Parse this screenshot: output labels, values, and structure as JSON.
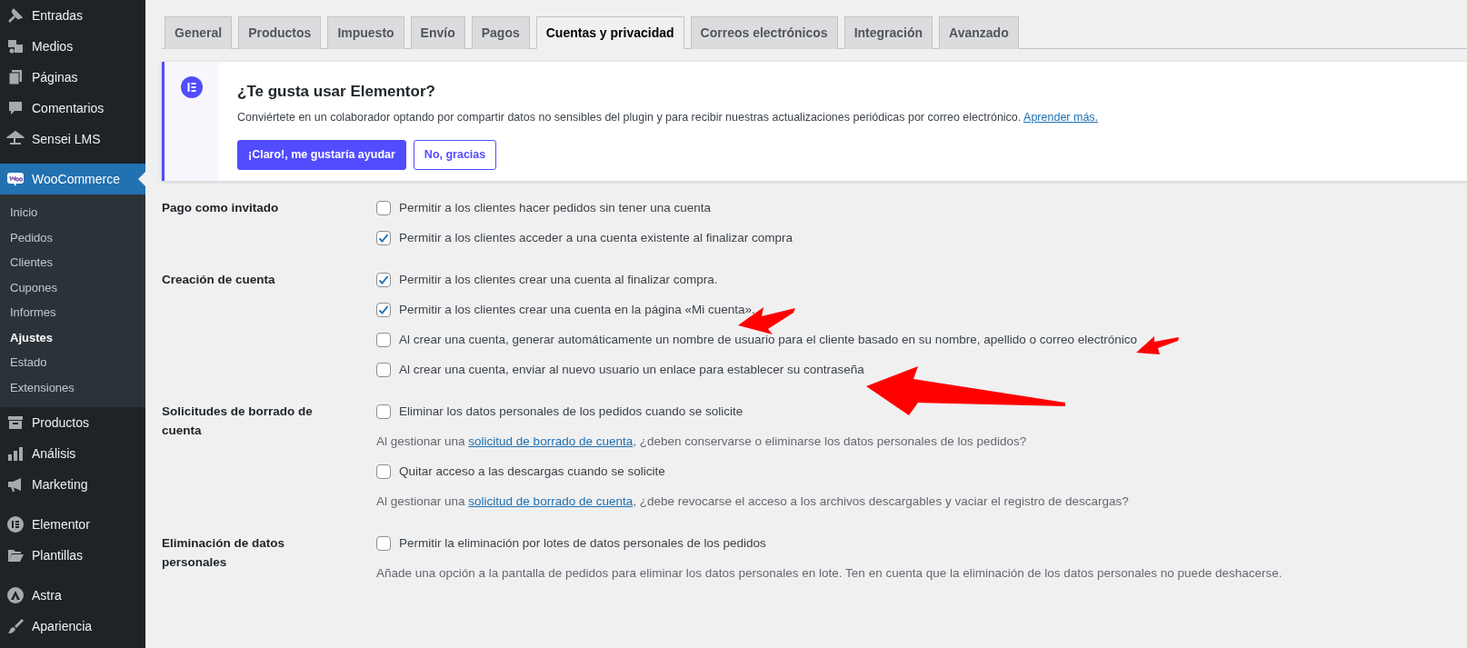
{
  "sidebar": {
    "items": [
      {
        "label": "Entradas",
        "selected": false
      },
      {
        "label": "Medios",
        "selected": false
      },
      {
        "label": "Páginas",
        "selected": false
      },
      {
        "label": "Comentarios",
        "selected": false
      },
      {
        "label": "Sensei LMS",
        "selected": false,
        "group_end": true
      },
      {
        "label": "WooCommerce",
        "selected": true,
        "expanded": true,
        "children": [
          {
            "label": "Inicio",
            "selected": false
          },
          {
            "label": "Pedidos",
            "selected": false
          },
          {
            "label": "Clientes",
            "selected": false
          },
          {
            "label": "Cupones",
            "selected": false
          },
          {
            "label": "Informes",
            "selected": false
          },
          {
            "label": "Ajustes",
            "selected": true
          },
          {
            "label": "Estado",
            "selected": false
          },
          {
            "label": "Extensiones",
            "selected": false
          }
        ]
      },
      {
        "label": "Productos",
        "selected": false
      },
      {
        "label": "Análisis",
        "selected": false
      },
      {
        "label": "Marketing",
        "selected": false,
        "group_end": true
      },
      {
        "label": "Elementor",
        "selected": false
      },
      {
        "label": "Plantillas",
        "selected": false,
        "group_end": true
      },
      {
        "label": "Astra",
        "selected": false
      },
      {
        "label": "Apariencia",
        "selected": false
      }
    ]
  },
  "tabs": [
    {
      "label": "General",
      "selected": false
    },
    {
      "label": "Productos",
      "selected": false
    },
    {
      "label": "Impuesto",
      "selected": false
    },
    {
      "label": "Envío",
      "selected": false
    },
    {
      "label": "Pagos",
      "selected": false
    },
    {
      "label": "Cuentas y privacidad",
      "selected": true
    },
    {
      "label": "Correos electrónicos",
      "selected": false
    },
    {
      "label": "Integración",
      "selected": false
    },
    {
      "label": "Avanzado",
      "selected": false
    }
  ],
  "notice": {
    "title": "¿Te gusta usar Elementor?",
    "text": "Conviértete en un colaborador optando por compartir datos no sensibles del plugin y para recibir nuestras actualizaciones periódicas por correo electrónico.",
    "link": "Aprender más.",
    "buttons": [
      {
        "label": "¡Claro!, me gustaría ayudar",
        "kind": "primary"
      },
      {
        "label": "No, gracias",
        "kind": "secondary"
      }
    ]
  },
  "sections": [
    {
      "label": "Pago como invitado",
      "items": [
        {
          "kind": "checkbox",
          "label": "Permitir a los clientes hacer pedidos sin tener una cuenta",
          "checked": false
        },
        {
          "kind": "checkbox",
          "label": "Permitir a los clientes acceder a una cuenta existente al finalizar compra",
          "checked": true
        }
      ]
    },
    {
      "label": "Creación de cuenta",
      "items": [
        {
          "kind": "checkbox",
          "label": "Permitir a los clientes crear una cuenta al finalizar compra.",
          "checked": true
        },
        {
          "kind": "checkbox",
          "label": "Permitir a los clientes crear una cuenta en la página «Mi cuenta».",
          "checked": true
        },
        {
          "kind": "checkbox",
          "label": "Al crear una cuenta, generar automáticamente un nombre de usuario para el cliente basado en su nombre, apellido o correo electrónico",
          "checked": false
        },
        {
          "kind": "checkbox",
          "label": "Al crear una cuenta, enviar al nuevo usuario un enlace para establecer su contraseña",
          "checked": false
        }
      ]
    },
    {
      "label": "Solicitudes de borrado de cuenta",
      "items": [
        {
          "kind": "checkbox",
          "label": "Eliminar los datos personales de los pedidos cuando se solicite",
          "checked": false
        },
        {
          "kind": "description",
          "before": "Al gestionar una",
          "link": "solicitud de borrado de cuenta",
          "after": ", ¿deben conservarse o eliminarse los datos personales de los pedidos?"
        },
        {
          "kind": "checkbox",
          "label": "Quitar acceso a las descargas cuando se solicite",
          "checked": false
        },
        {
          "kind": "description",
          "before": "Al gestionar una",
          "link": "solicitud de borrado de cuenta",
          "after": ", ¿debe revocarse el acceso a los archivos descargables y vaciar el registro de descargas?"
        }
      ]
    },
    {
      "label": "Eliminación de datos personales",
      "items": [
        {
          "kind": "checkbox",
          "label": "Permitir la eliminación por lotes de datos personales de los pedidos",
          "checked": false
        },
        {
          "kind": "description",
          "before": "Añade una opción a la pantalla de pedidos para eliminar los datos personales en lote. Ten en cuenta que la eliminación de los datos personales no puede deshacerse."
        }
      ]
    }
  ]
}
